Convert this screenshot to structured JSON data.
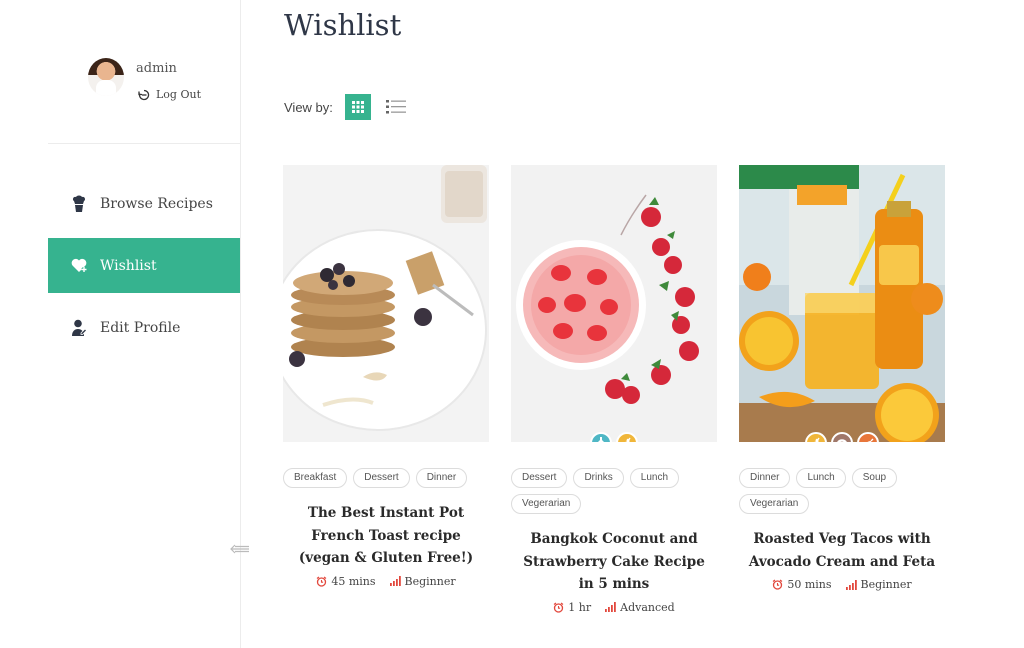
{
  "sidebar": {
    "user": {
      "name": "admin",
      "logout_label": "Log Out"
    },
    "items": [
      {
        "label": "Browse Recipes",
        "icon": "chef-icon",
        "active": false
      },
      {
        "label": "Wishlist",
        "icon": "heart-icon",
        "active": true
      },
      {
        "label": "Edit Profile",
        "icon": "user-icon",
        "active": false
      }
    ]
  },
  "main": {
    "title": "Wishlist",
    "view_by_label": "View by:",
    "view_modes": [
      "grid",
      "list"
    ],
    "active_view": "grid"
  },
  "recipes": [
    {
      "title": "The Best Instant Pot French Toast recipe (vegan & Gluten Free!)",
      "tags": [
        "Breakfast",
        "Dessert",
        "Dinner"
      ],
      "time": "45 mins",
      "level": "Beginner",
      "badges": []
    },
    {
      "title": "Bangkok Coconut and Strawberry Cake Recipe in 5 mins",
      "tags": [
        "Dessert",
        "Drinks",
        "Lunch",
        "Vegerarian"
      ],
      "time": "1 hr",
      "level": "Advanced",
      "badges": [
        "bottle-icon",
        "wheat-icon"
      ]
    },
    {
      "title": "Roasted Veg Tacos with Avocado Cream and Feta",
      "tags": [
        "Dinner",
        "Lunch",
        "Soup",
        "Vegerarian"
      ],
      "time": "50 mins",
      "level": "Beginner",
      "badges": [
        "wheat-icon",
        "meat-icon",
        "pepper-icon"
      ]
    }
  ],
  "colors": {
    "accent": "#36b38f",
    "meta_icon": "#e2483d",
    "badge_teal": "#4fb7c5",
    "badge_yellow": "#f0b63a",
    "badge_brown": "#a0786a",
    "badge_orange": "#e8763a"
  }
}
